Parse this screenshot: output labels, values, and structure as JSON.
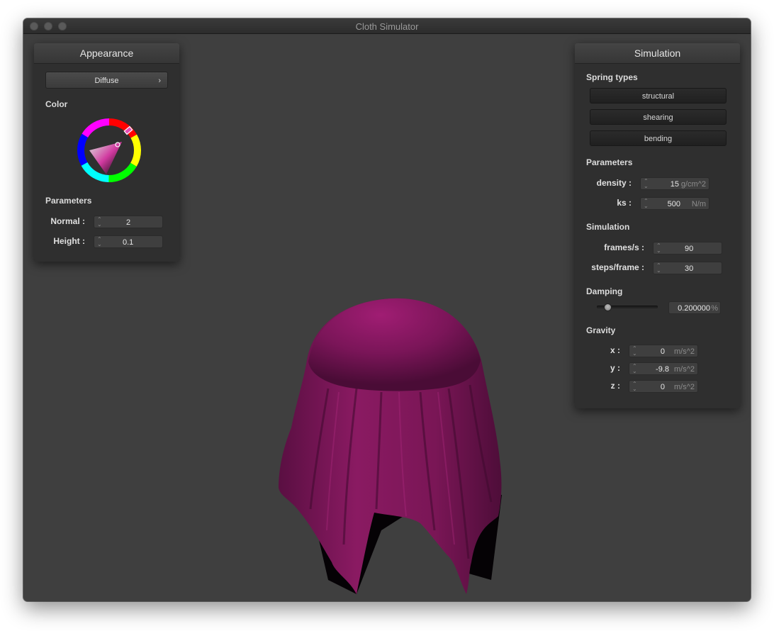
{
  "window": {
    "title": "Cloth Simulator"
  },
  "appearance": {
    "header": "Appearance",
    "shader_select": "Diffuse",
    "color_label": "Color",
    "selected_color": "#8a1a60",
    "params_label": "Parameters",
    "normal_label": "Normal :",
    "normal_value": "2",
    "height_label": "Height :",
    "height_value": "0.1"
  },
  "simulation": {
    "header": "Simulation",
    "spring_types_label": "Spring types",
    "spring_buttons": [
      "structural",
      "shearing",
      "bending"
    ],
    "params_label": "Parameters",
    "density_label": "density :",
    "density_value": "15",
    "density_unit": "g/cm^2",
    "ks_label": "ks :",
    "ks_value": "500",
    "ks_unit": "N/m",
    "sim_label": "Simulation",
    "fps_label": "frames/s :",
    "fps_value": "90",
    "steps_label": "steps/frame :",
    "steps_value": "30",
    "damping_label": "Damping",
    "damping_value": "0.200000",
    "damping_unit": "%",
    "damping_slider_fraction": 0.2,
    "gravity_label": "Gravity",
    "gx_label": "x :",
    "gx_value": "0",
    "gy_label": "y :",
    "gy_value": "-9.8",
    "gz_label": "z :",
    "gz_value": "0",
    "gravity_unit": "m/s^2"
  },
  "cloth": {
    "color": "#9a1b6e"
  }
}
